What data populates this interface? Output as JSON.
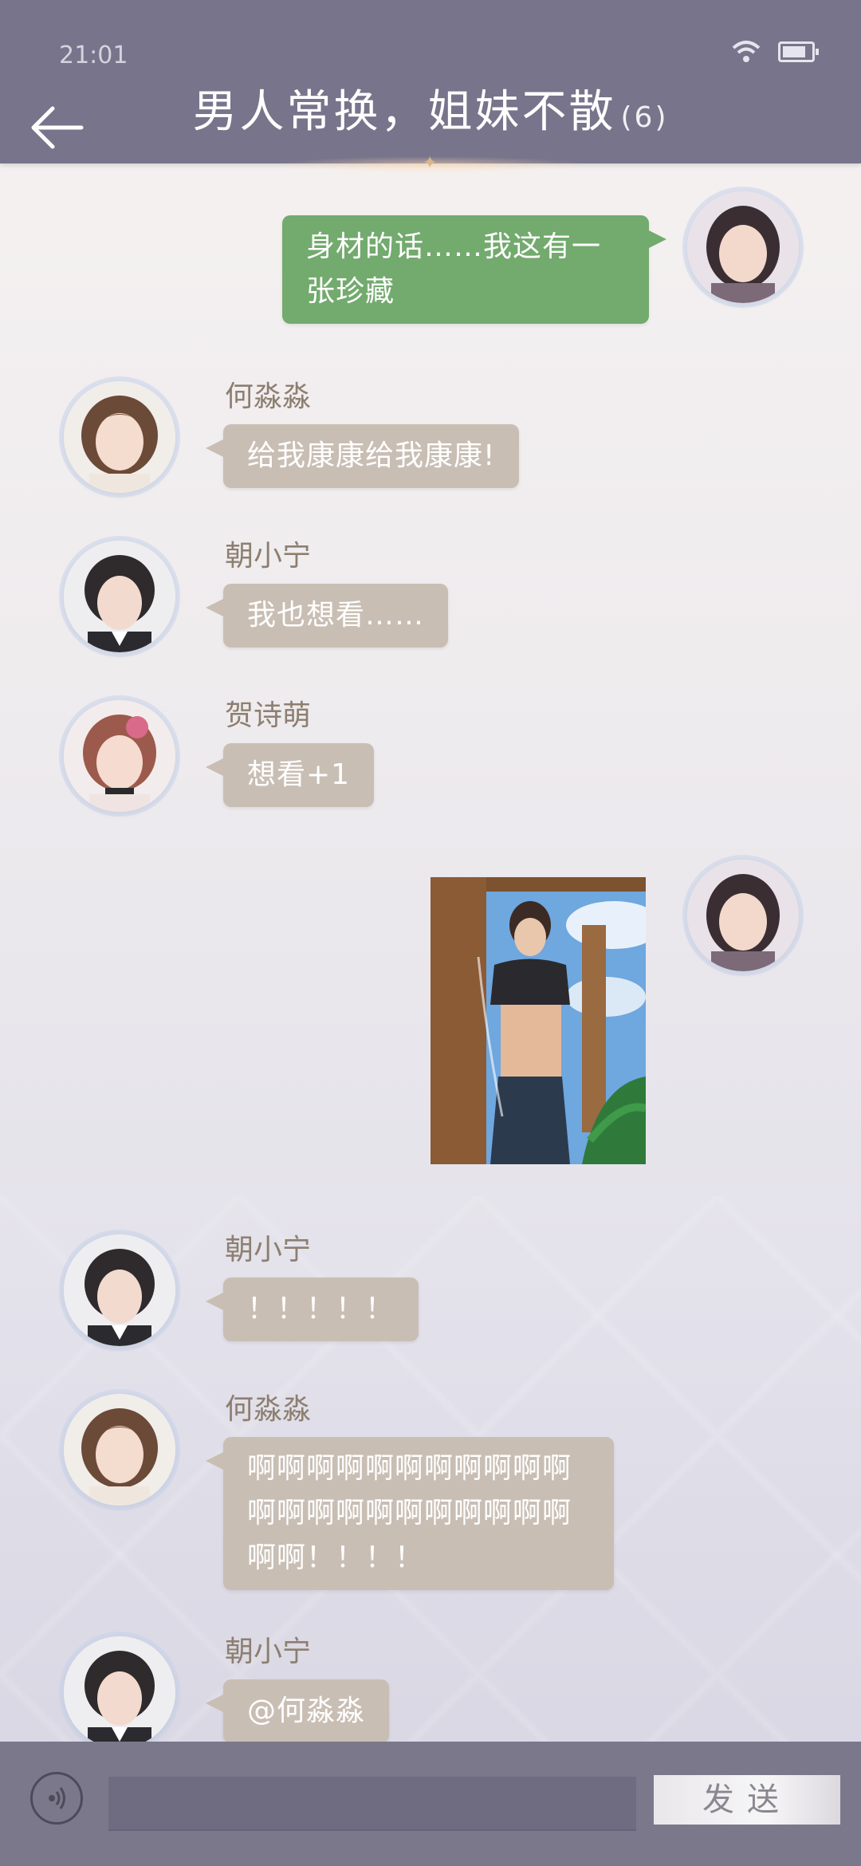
{
  "status_bar": {
    "time": "21:01"
  },
  "header": {
    "title": "男人常换，姐妹不散",
    "member_count": "(6)"
  },
  "messages": [
    {
      "sender": "",
      "text": "身材的话……我这有一张珍藏",
      "mine": true
    },
    {
      "sender": "何淼淼",
      "text": "给我康康给我康康!",
      "mine": false
    },
    {
      "sender": "朝小宁",
      "text": "我也想看……",
      "mine": false
    },
    {
      "sender": "贺诗萌",
      "text": "想看+1",
      "mine": false
    },
    {
      "sender": "",
      "text": "",
      "mine": true,
      "type": "image"
    },
    {
      "sender": "朝小宁",
      "text": "！！！！！",
      "mine": false
    },
    {
      "sender": "何淼淼",
      "text": "啊啊啊啊啊啊啊啊啊啊啊啊啊啊啊啊啊啊啊啊啊啊啊啊！！！！",
      "mine": false
    },
    {
      "sender": "朝小宁",
      "text": "@何淼淼",
      "mine": false
    }
  ],
  "composer": {
    "input_value": "",
    "send_label": "发送"
  },
  "colors": {
    "header": "#78748b",
    "my_bubble": "#73aa6e",
    "other_bubble": "#c9beb4"
  }
}
